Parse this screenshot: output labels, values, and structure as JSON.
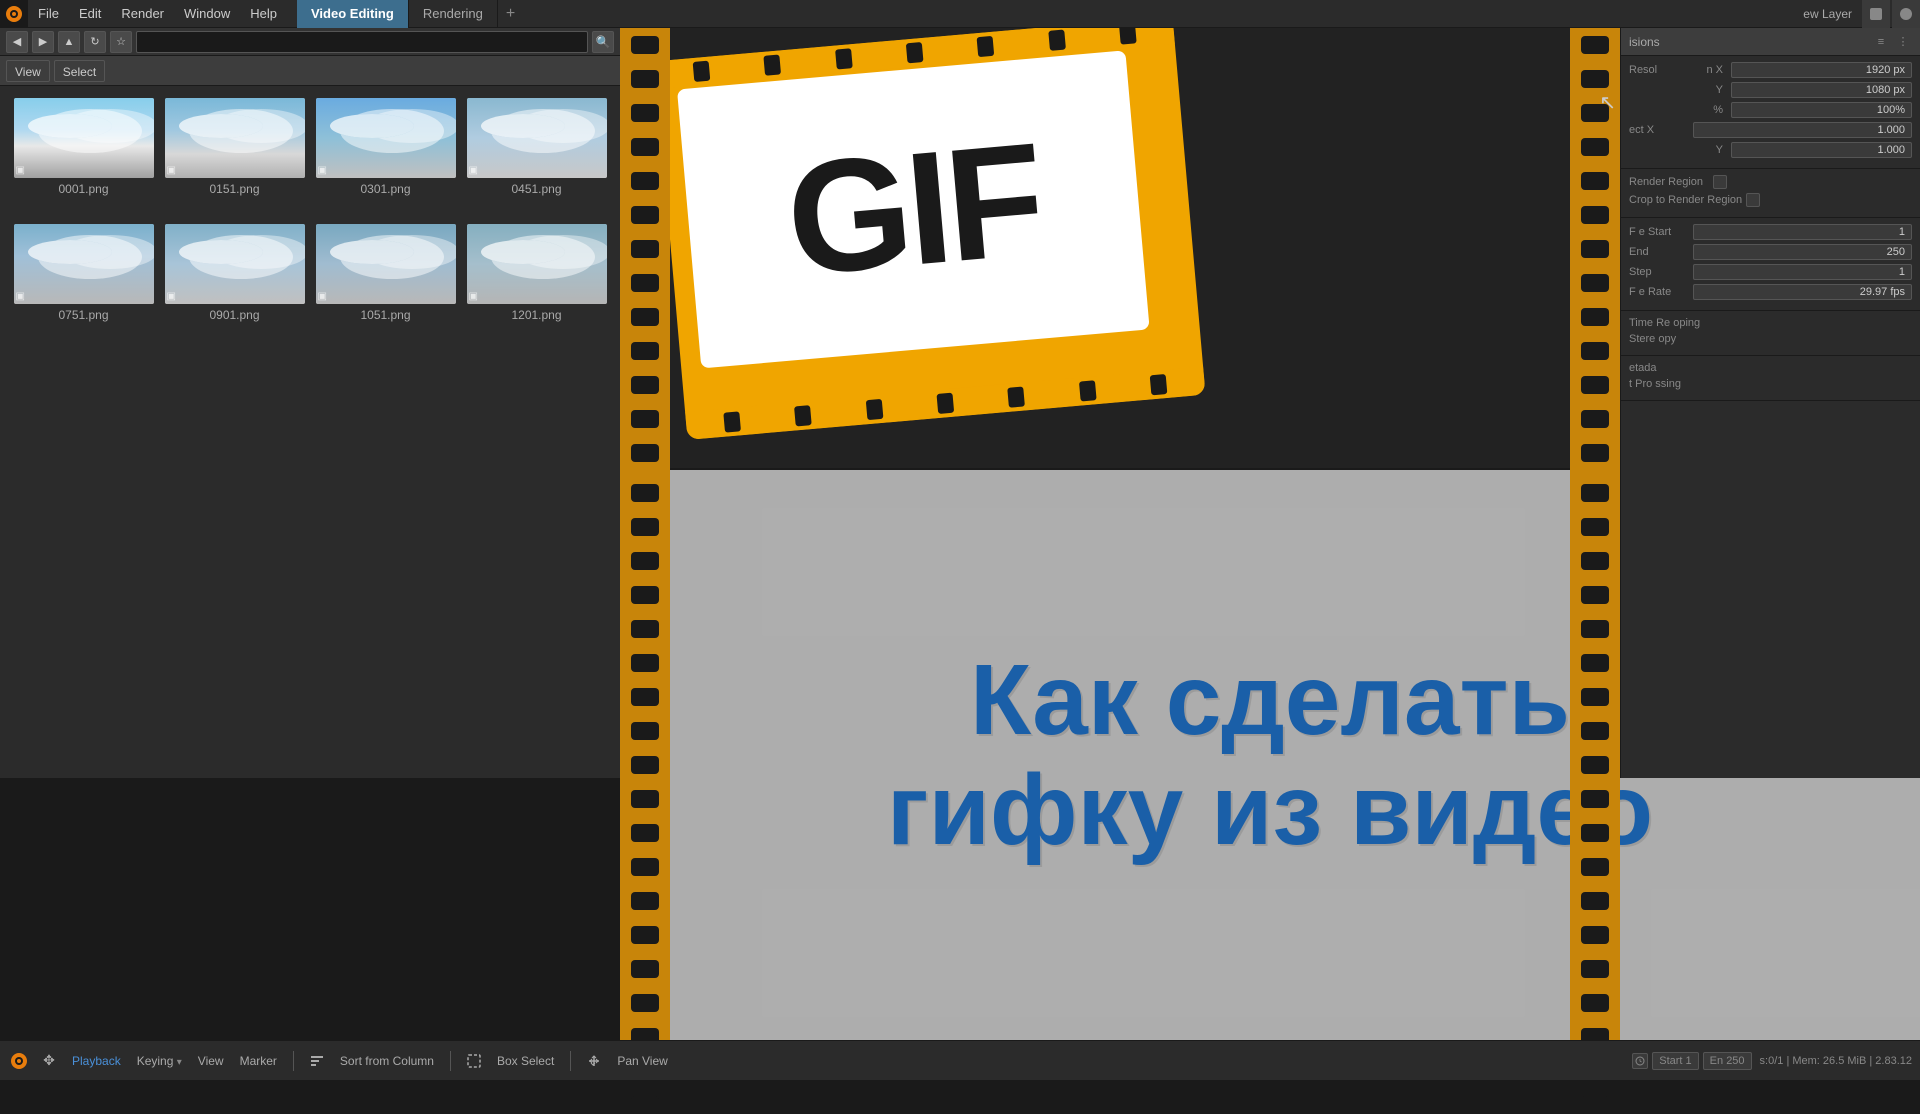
{
  "app": {
    "title": "Blender Video Editing"
  },
  "menubar": {
    "logo": "blender-logo",
    "menus": [
      "File",
      "Edit",
      "Render",
      "Window",
      "Help"
    ],
    "workspace_tabs": [
      "Video Editing",
      "Rendering"
    ],
    "active_workspace": "Video Editing"
  },
  "browser": {
    "nav_buttons": [
      "back",
      "forward",
      "up",
      "refresh",
      "bookmark"
    ],
    "path_placeholder": "",
    "search_placeholder": "🔍",
    "view_label": "View",
    "select_label": "Select",
    "thumbnails": [
      {
        "filename": "0001.png",
        "index": 0
      },
      {
        "filename": "0151.png",
        "index": 1
      },
      {
        "filename": "0301.png",
        "index": 2
      },
      {
        "filename": "0451.png",
        "index": 3
      },
      {
        "filename": "0751.png",
        "index": 4
      },
      {
        "filename": "0901.png",
        "index": 5
      },
      {
        "filename": "1051.png",
        "index": 6
      },
      {
        "filename": "1201.png",
        "index": 7
      }
    ]
  },
  "preview": {
    "gif_text": "GIF"
  },
  "text_overlay": {
    "line1": "Как сделать",
    "line2": "гифку из видео"
  },
  "properties_panel": {
    "title": "isions",
    "resolution": {
      "x_label": "Resol",
      "x_suffix": "n X",
      "x_value": "1920 px",
      "y_value": "1080 px",
      "percent_value": "100%",
      "aspect_x_label": "ect X",
      "aspect_x_value": "1.000",
      "aspect_y_value": "1.000"
    },
    "render_region_label": "Render Region",
    "crop_label": "Crop to Render Region",
    "frame": {
      "start_label": "F e Start",
      "start_value": "1",
      "end_label": "End",
      "end_value": "250",
      "step_label": "Step",
      "step_value": "1",
      "rate_label": "F e Rate",
      "rate_value": "29.97 fps"
    },
    "time_remapping_label": "Time Re oping",
    "stereo_label": "Stere opy",
    "metadata_label": "etada",
    "post_processing_label": "t Pro ssing"
  },
  "view_layer": {
    "label": "ew Layer"
  },
  "bottom_bar": {
    "playback_label": "Playback",
    "keying_label": "Keying",
    "view_label": "View",
    "marker_label": "Marker",
    "sort_label": "Sort from Column",
    "box_select_label": "Box Select",
    "pan_view_label": "Pan View",
    "start_label": "Start",
    "start_value": "1",
    "end_label": "En",
    "end_value": "250",
    "frame_info": "s:0/1 | Mem: 26.5 MiB | 2.83.12"
  }
}
